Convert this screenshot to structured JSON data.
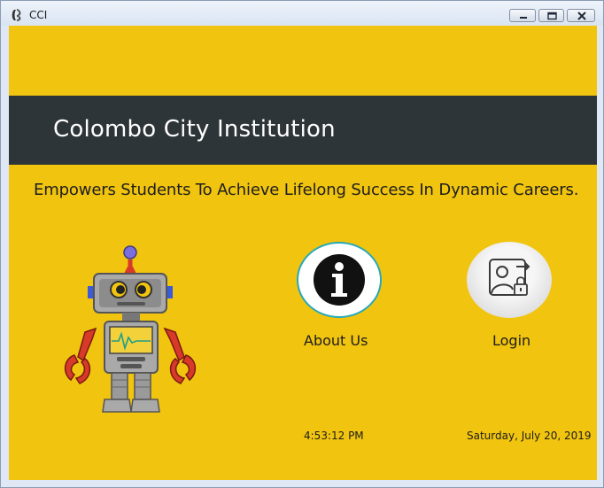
{
  "window": {
    "title": "CCI",
    "app_icon": "app-logo-icon",
    "controls": [
      "minimize-icon",
      "maximize-icon",
      "close-icon"
    ]
  },
  "banner": {
    "title": "Colombo City Institution"
  },
  "tagline": "Empowers Students To Achieve Lifelong Success In Dynamic Careers.",
  "buttons": {
    "about": {
      "label": "About Us",
      "icon": "info-icon"
    },
    "login": {
      "label": "Login",
      "icon": "login-user-icon"
    }
  },
  "status": {
    "time": "4:53:12 PM",
    "date": "Saturday, July 20, 2019"
  },
  "colors": {
    "background": "#f1c40f",
    "banner": "#2e3538",
    "accent": "#27a9b9"
  }
}
